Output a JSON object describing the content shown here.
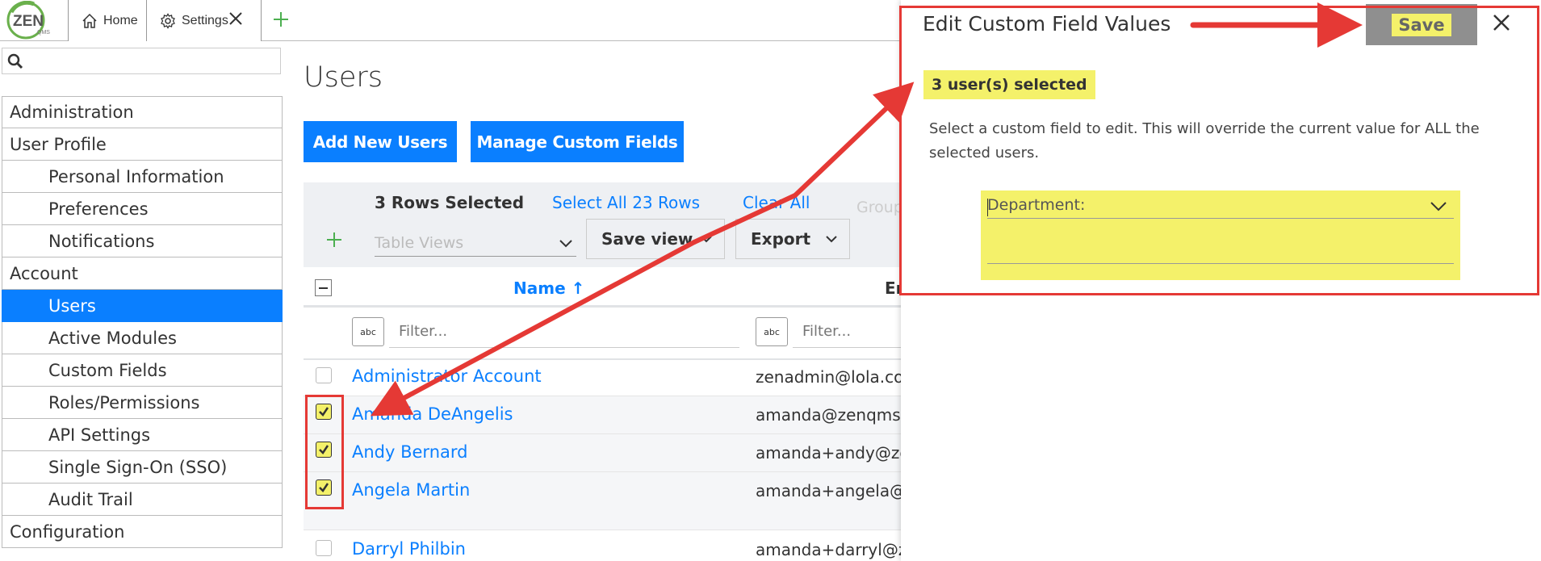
{
  "tabs": {
    "home_label": "Home",
    "settings_label": "Settings"
  },
  "search": {
    "placeholder": ""
  },
  "sidebar": {
    "items": [
      {
        "label": "Administration",
        "level": "section"
      },
      {
        "label": "User Profile",
        "level": "section"
      },
      {
        "label": "Personal Information",
        "level": "sub"
      },
      {
        "label": "Preferences",
        "level": "sub"
      },
      {
        "label": "Notifications",
        "level": "sub"
      },
      {
        "label": "Account",
        "level": "section"
      },
      {
        "label": "Users",
        "level": "sub",
        "active": true
      },
      {
        "label": "Active Modules",
        "level": "sub"
      },
      {
        "label": "Custom Fields",
        "level": "sub"
      },
      {
        "label": "Roles/Permissions",
        "level": "sub"
      },
      {
        "label": "API Settings",
        "level": "sub"
      },
      {
        "label": "Single Sign-On (SSO)",
        "level": "sub"
      },
      {
        "label": "Audit Trail",
        "level": "sub"
      },
      {
        "label": "Configuration",
        "level": "section"
      }
    ]
  },
  "main": {
    "title": "Users",
    "add_users_label": "Add New Users",
    "manage_fields_label": "Manage Custom Fields",
    "rows_selected": "3 Rows Selected",
    "select_all_label": "Select All 23 Rows",
    "clear_all_label": "Clear All",
    "group_placeholder": "Group",
    "table_views_placeholder": "Table Views",
    "save_view_label": "Save view",
    "export_label": "Export",
    "columns": {
      "name": "Name ↑",
      "email": "Email"
    },
    "filter_placeholder": "Filter...",
    "abc_label": "abc",
    "rows": [
      {
        "name": "Administrator Account",
        "email": "zenadmin@lola.com",
        "checked": false
      },
      {
        "name": "Amanda DeAngelis",
        "email": "amanda@zenqms.com",
        "checked": true
      },
      {
        "name": "Andy Bernard",
        "email": "amanda+andy@zenqms.com",
        "checked": true
      },
      {
        "name": "Angela Martin",
        "email": "amanda+angela@zenqms.com",
        "checked": true
      },
      {
        "name": "Darryl Philbin",
        "email": "amanda+darryl@zenqms.com",
        "checked": false
      }
    ]
  },
  "modal": {
    "title": "Edit Custom Field Values",
    "save_label": "Save",
    "selected_badge": "3 user(s) selected",
    "description": "Select a custom field to edit. This will override the current value for ALL the selected users.",
    "field_label": "Department:"
  },
  "colors": {
    "accent": "#0a7fff",
    "highlight": "#f4f16a",
    "annotation": "#e53935",
    "logo_green": "#6ab04c"
  },
  "icons": [
    "home-icon",
    "gear-icon",
    "close-icon",
    "plus-icon",
    "search-icon",
    "chevron-down-icon",
    "check-icon",
    "zen-logo"
  ]
}
